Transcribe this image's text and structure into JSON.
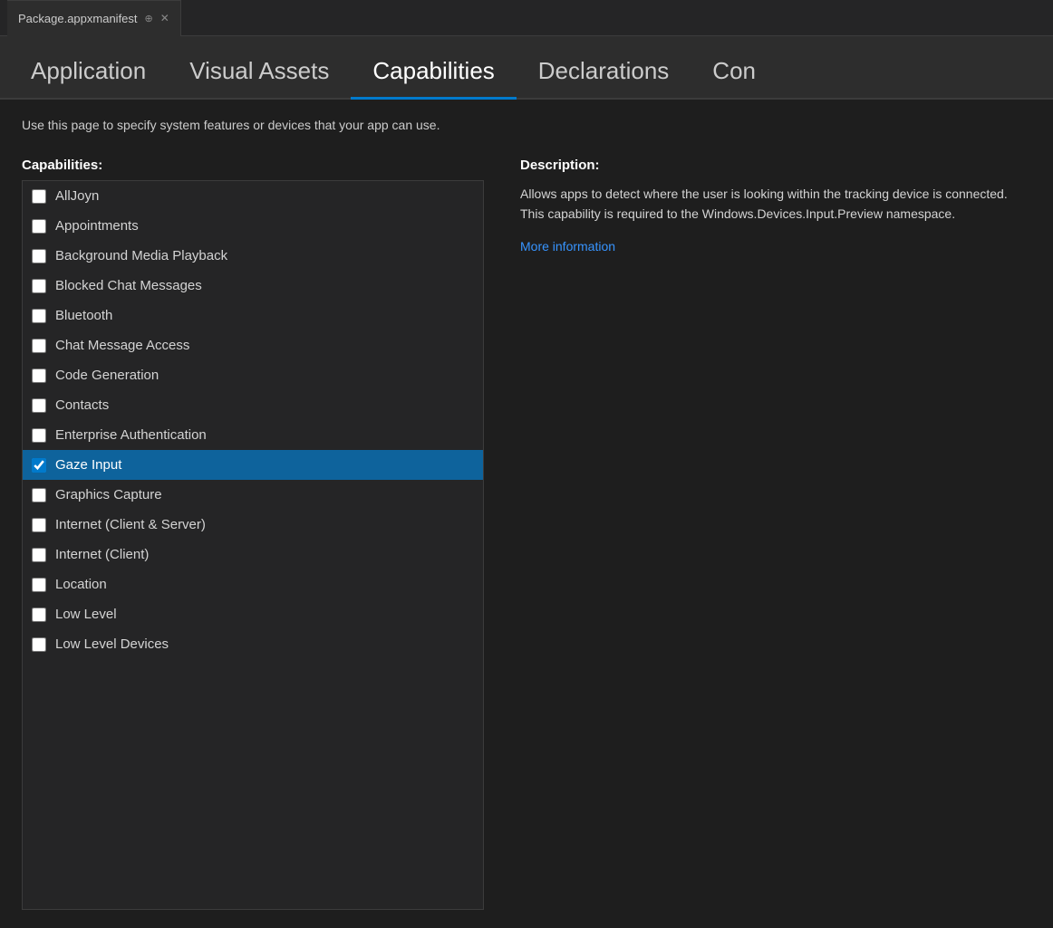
{
  "titlebar": {
    "tab_name": "Package.appxmanifest",
    "pin_icon": "📌",
    "close_icon": "✕"
  },
  "nav": {
    "tabs": [
      {
        "id": "application",
        "label": "Application",
        "active": false
      },
      {
        "id": "visual-assets",
        "label": "Visual Assets",
        "active": false
      },
      {
        "id": "capabilities",
        "label": "Capabilities",
        "active": true
      },
      {
        "id": "declarations",
        "label": "Declarations",
        "active": false
      },
      {
        "id": "con",
        "label": "Con",
        "active": false
      }
    ]
  },
  "page": {
    "description": "Use this page to specify system features or devices that your app can use.",
    "capabilities_label": "Capabilities:",
    "description_label": "Description:",
    "description_text": "Allows apps to detect where the user is looking within the tracking device is connected. This capability is required to the Windows.Devices.Input.Preview namespace.",
    "more_info_label": "More information",
    "capabilities": [
      {
        "id": "alljoyn",
        "label": "AllJoyn",
        "checked": false,
        "selected": false
      },
      {
        "id": "appointments",
        "label": "Appointments",
        "checked": false,
        "selected": false
      },
      {
        "id": "background-media-playback",
        "label": "Background Media Playback",
        "checked": false,
        "selected": false
      },
      {
        "id": "blocked-chat-messages",
        "label": "Blocked Chat Messages",
        "checked": false,
        "selected": false
      },
      {
        "id": "bluetooth",
        "label": "Bluetooth",
        "checked": false,
        "selected": false
      },
      {
        "id": "chat-message-access",
        "label": "Chat Message Access",
        "checked": false,
        "selected": false
      },
      {
        "id": "code-generation",
        "label": "Code Generation",
        "checked": false,
        "selected": false
      },
      {
        "id": "contacts",
        "label": "Contacts",
        "checked": false,
        "selected": false
      },
      {
        "id": "enterprise-authentication",
        "label": "Enterprise Authentication",
        "checked": false,
        "selected": false
      },
      {
        "id": "gaze-input",
        "label": "Gaze Input",
        "checked": true,
        "selected": true
      },
      {
        "id": "graphics-capture",
        "label": "Graphics Capture",
        "checked": false,
        "selected": false
      },
      {
        "id": "internet-client-server",
        "label": "Internet (Client & Server)",
        "checked": false,
        "selected": false
      },
      {
        "id": "internet-client",
        "label": "Internet (Client)",
        "checked": false,
        "selected": false
      },
      {
        "id": "location",
        "label": "Location",
        "checked": false,
        "selected": false
      },
      {
        "id": "low-level",
        "label": "Low Level",
        "checked": false,
        "selected": false
      },
      {
        "id": "low-level-devices",
        "label": "Low Level Devices",
        "checked": false,
        "selected": false
      }
    ]
  }
}
